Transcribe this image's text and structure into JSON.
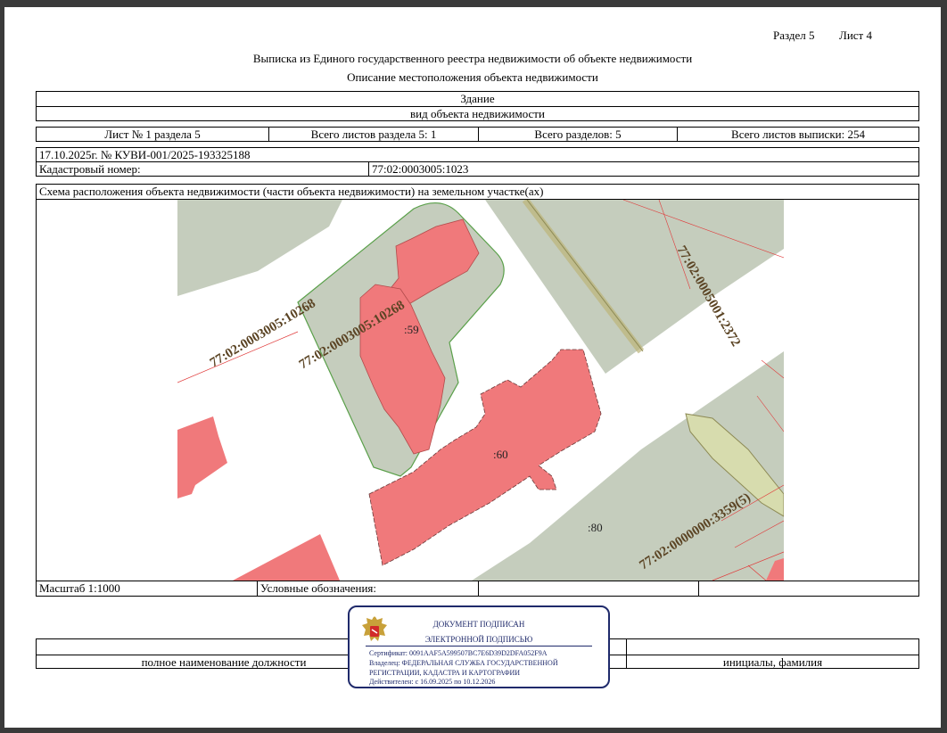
{
  "header": {
    "section": "Раздел 5",
    "sheet": "Лист 4",
    "title": "Выписка из Единого государственного реестра недвижимости об объекте недвижимости",
    "subtitle": "Описание местоположения объекта недвижимости"
  },
  "object": {
    "type": "Здание",
    "type_caption": "вид объекта недвижимости"
  },
  "sheet_info": {
    "sheet_of_section": "Лист № 1 раздела 5",
    "sheets_in_section": "Всего листов раздела 5: 1",
    "sections_total": "Всего разделов: 5",
    "sheets_total": "Всего листов выписки: 254"
  },
  "record": {
    "date_number": "17.10.2025г. № КУВИ-001/2025-193325188",
    "cadastral_label": "Кадастровый номер:",
    "cadastral_value": "77:02:0003005:1023"
  },
  "map": {
    "caption": "Схема расположения объекта недвижимости (части объекта недвижимости) на земельном участке(ах)",
    "labels": {
      "parcel_outer": "77:02:0003005:10268",
      "parcel_inner": "77:02:0003005:10268",
      "parcel_right": "77:02:0005001:2372",
      "parcel_road": "77:02:0000000:3359(5)",
      "bldg_59": ":59",
      "bldg_60": ":60",
      "area_80": ":80"
    },
    "colors": {
      "land": "#c5cdbd",
      "building": "#f0797b",
      "road_fill": "#d7dcae",
      "border_green": "#5aa04a",
      "line_red": "#e03a3a",
      "label_brown": "#5b4424"
    }
  },
  "footer": {
    "scale": "Масштаб 1:1000",
    "legend_label": "Условные обозначения:",
    "position_caption": "полное наименование должности",
    "name_caption": "инициалы, фамилия"
  },
  "stamp": {
    "line1": "ДОКУМЕНТ ПОДПИСАН",
    "line2": "ЭЛЕКТРОННОЙ ПОДПИСЬЮ",
    "certificate": "Сертификат: 0091AAF5A599507BC7E6D39D2DFA052F9A",
    "owner1": "Владелец: ФЕДЕРАЛЬНАЯ СЛУЖБА ГОСУДАРСТВЕННОЙ",
    "owner2": "РЕГИСТРАЦИИ, КАДАСТРА И КАРТОГРАФИИ",
    "valid": "Действителен: с 16.09.2025 по 10.12.2026",
    "emblem": "russian-coat-of-arms-icon"
  }
}
